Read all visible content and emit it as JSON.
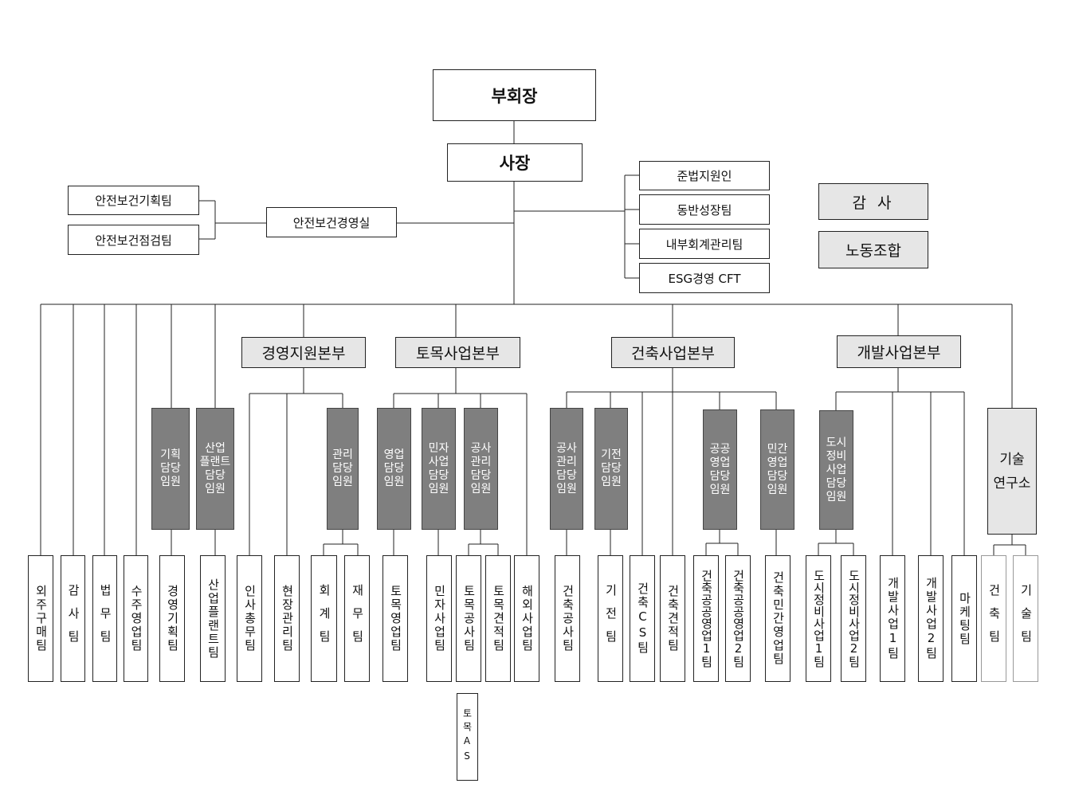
{
  "top": {
    "vice_chairman": "부회장",
    "president": "사장"
  },
  "safety": {
    "office": "안전보건경영실",
    "planning_team": "안전보건기획팀",
    "inspection_team": "안전보건점검팀"
  },
  "staff": {
    "compliance": "준법지원인",
    "win_win": "동반성장팀",
    "internal_accounting": "내부회계관리팀",
    "esg": "ESG경영 CFT"
  },
  "independent": {
    "audit": "감 사",
    "union": "노동조합"
  },
  "divisions": {
    "management": "경영지원본부",
    "civil": "토목사업본부",
    "architecture": "건축사업본부",
    "development": "개발사업본부"
  },
  "officers": {
    "planning": "기획\n담당\n임원",
    "plant": "산업\n플랜트\n담당\n임원",
    "admin": "관리\n담당\n임원",
    "civil_sales": "영업\n담당\n임원",
    "civil_private": "민자\n사업\n담당\n임원",
    "civil_construction_mgmt": "공사\n관리\n담당\n임원",
    "arch_construction_mgmt": "공사\n관리\n담당\n임원",
    "arch_electrical": "기전\n담당\n임원",
    "arch_public_sales": "공공\n영업\n담당\n임원",
    "arch_private_sales": "민간\n영업\n담당\n임원",
    "dev_urban": "도시\n정비\n사업\n담당\n임원"
  },
  "research_lab": "기술\n연구소",
  "teams": {
    "outsourcing": "외주구매팀",
    "audit": "감사팀",
    "legal": "법무팀",
    "order_sales": "수주영업팀",
    "business_planning": "경영기획팀",
    "industrial_plant": "산업플랜트팀",
    "hr_general": "인사총무팀",
    "site_management": "현장관리팀",
    "accounting": "회계팀",
    "finance": "재무팀",
    "civil_sales": "토목영업팀",
    "private_business": "민자사업팀",
    "civil_construction": "토목공사팀",
    "civil_estimation": "토목견적팀",
    "overseas": "해외사업팀",
    "arch_construction": "건축공사팀",
    "electrical": "기전팀",
    "arch_cs": "건축CS팀",
    "arch_estimation": "건축견적팀",
    "arch_public_1": "건축공공영업1팀",
    "arch_public_2": "건축공공영업2팀",
    "arch_private_sales": "건축민간영업팀",
    "urban_1": "도시정비사업1팀",
    "urban_2": "도시정비사업2팀",
    "dev_1": "개발사업1팀",
    "dev_2": "개발사업2팀",
    "marketing": "마케팅팀",
    "architecture": "건축팀",
    "technology": "기술팀",
    "civil_as": "토목AS"
  }
}
